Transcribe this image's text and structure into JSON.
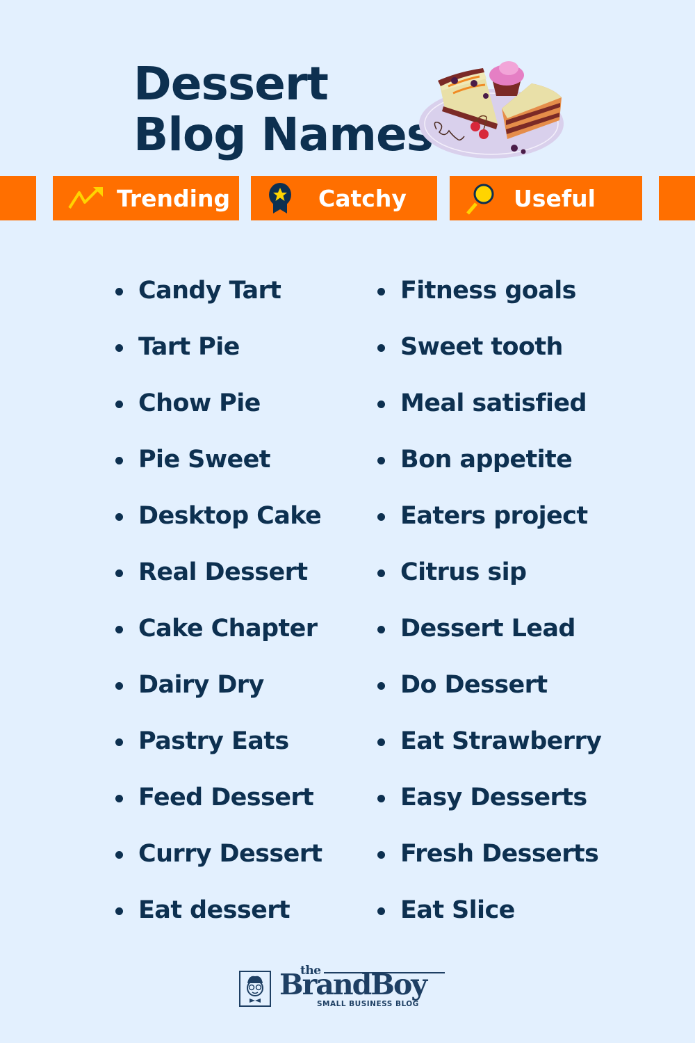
{
  "header": {
    "title_line1": "Dessert",
    "title_line2": "Blog Names"
  },
  "tags": [
    {
      "label": "Trending",
      "icon": "trending-up-icon"
    },
    {
      "label": "Catchy",
      "icon": "award-badge-icon"
    },
    {
      "label": "Useful",
      "icon": "magnifier-icon"
    }
  ],
  "colors": {
    "background": "#e3f0fe",
    "accent_orange": "#ff6f00",
    "text_navy": "#0d3050",
    "icon_yellow": "#ffd400"
  },
  "names_left": [
    "Candy Tart",
    "Tart Pie",
    "Chow Pie",
    "Pie Sweet",
    "Desktop Cake",
    "Real Dessert",
    "Cake Chapter",
    "Dairy Dry",
    "Pastry Eats",
    "Feed Dessert",
    "Curry Dessert",
    "Eat dessert"
  ],
  "names_right": [
    "Fitness goals",
    "Sweet tooth",
    "Meal satisfied",
    "Bon appetite",
    "Eaters project",
    "Citrus sip",
    "Dessert Lead",
    "Do Dessert",
    "Eat Strawberry",
    "Easy Desserts",
    "Fresh Desserts",
    "Eat Slice"
  ],
  "footer": {
    "logo_the": "the",
    "logo_brand": "BrandBoy",
    "logo_tagline": "SMALL BUSINESS BLOG"
  }
}
